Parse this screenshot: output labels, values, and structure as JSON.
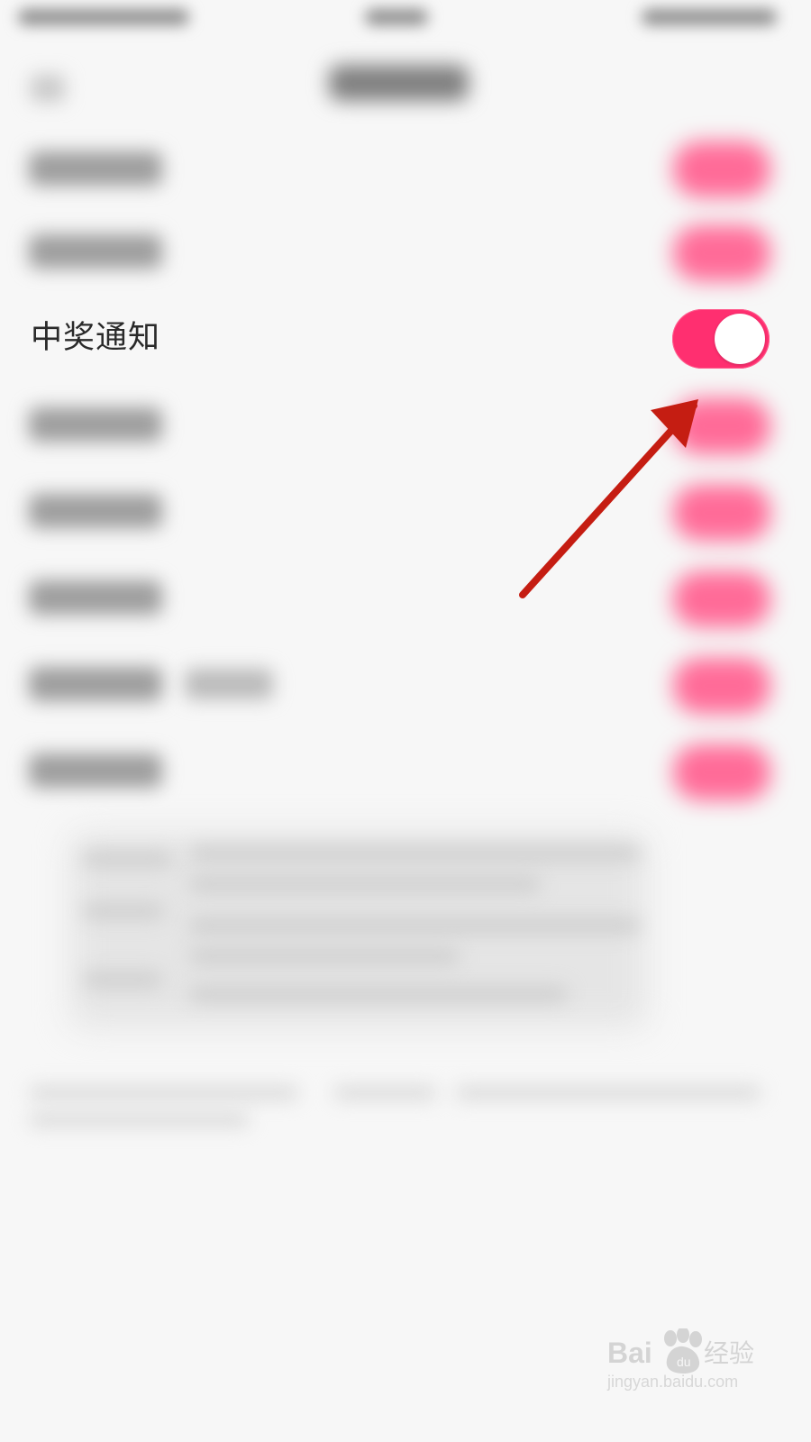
{
  "settings": {
    "featured_item": {
      "label": "中奖通知",
      "toggle_state": "on"
    }
  },
  "watermark": {
    "brand": "Bai",
    "brand_suffix": "经验",
    "url": "jingyan.baidu.com"
  },
  "colors": {
    "toggle_on": "#ff2f70",
    "blurred_toggle": "#ff6b98",
    "annotation_arrow": "#c51d12",
    "background": "#f7f7f7"
  },
  "icons": {
    "annotation": "arrow-pointing-to-toggle",
    "watermark": "paw-icon"
  }
}
